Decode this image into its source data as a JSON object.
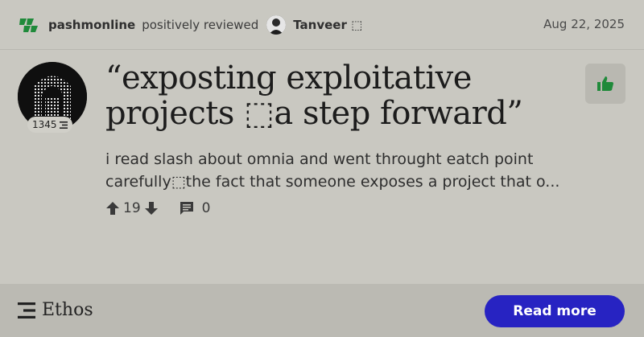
{
  "header": {
    "author": "pashmonline",
    "action": "positively reviewed",
    "target": "Tanveer ⬚",
    "date": "Aug 22, 2025"
  },
  "review": {
    "score": "1345",
    "title": "“exposting exploitative projects ⬚a step forward”",
    "body": "i read slash about omnia and went throught eatch point carefully⬚the fact that someone exposes a project that o...",
    "upvotes": "19",
    "comments": "0"
  },
  "footer": {
    "brand": "Ethos",
    "read_more": "Read more"
  },
  "colors": {
    "background": "#c9c8c1",
    "accent_green": "#1f8a3a",
    "button_blue": "#2723c2"
  },
  "icons": {
    "brand": "ethos-green-chevrons-icon",
    "thumbs_up": "thumbs-up-icon",
    "up": "arrow-up-icon",
    "down": "arrow-down-icon",
    "comment": "comment-icon",
    "ethos_logo": "ethos-logo-icon"
  }
}
